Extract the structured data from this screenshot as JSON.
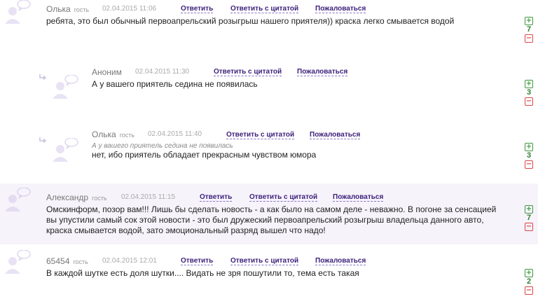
{
  "labels": {
    "reply": "Ответить",
    "quote": "Ответить с цитатой",
    "report": "Пожаловаться",
    "guest": "гость"
  },
  "comments": [
    {
      "author": "Олька",
      "date": "02.04.2015 11:06",
      "text": "ребята, это был обычный первоапрельский розыгрыш нашего приятеля)) краска легко смывается водой",
      "score": "7"
    },
    {
      "author": "Аноним",
      "date": "02.04.2015 11:30",
      "text": "А у вашего приятель седина не появилась",
      "score": "3"
    },
    {
      "author": "Олька",
      "date": "02.04.2015 11:40",
      "quote": "А у вашего приятель седина не появилась",
      "text": "нет, ибо приятель обладает прекрасным чувством юмора",
      "score": "3"
    },
    {
      "author": "Александр",
      "date": "02.04.2015 11:15",
      "text": "Омскинформ, позор вам!!! Лишь бы сделать новость - а как было на самом деле - неважно. В погоне за сенсацией вы упустили самый сок этой новости - это был дружеский первоапрельский розыгрыш владельца данного авто, краска смывается водой, зато эмоциональный разряд вышел что надо!",
      "score": "7"
    },
    {
      "author": "65454",
      "date": "02.04.2015 12:01",
      "text": "В каждой шутке есть доля шутки.... Видать не зря пошутили то, тема есть такая",
      "score": "2"
    }
  ],
  "colors": {
    "accent": "#3b1f7a",
    "positive": "#2e7d32",
    "negative": "#dd4444",
    "highlight": "#f6f3fb"
  }
}
